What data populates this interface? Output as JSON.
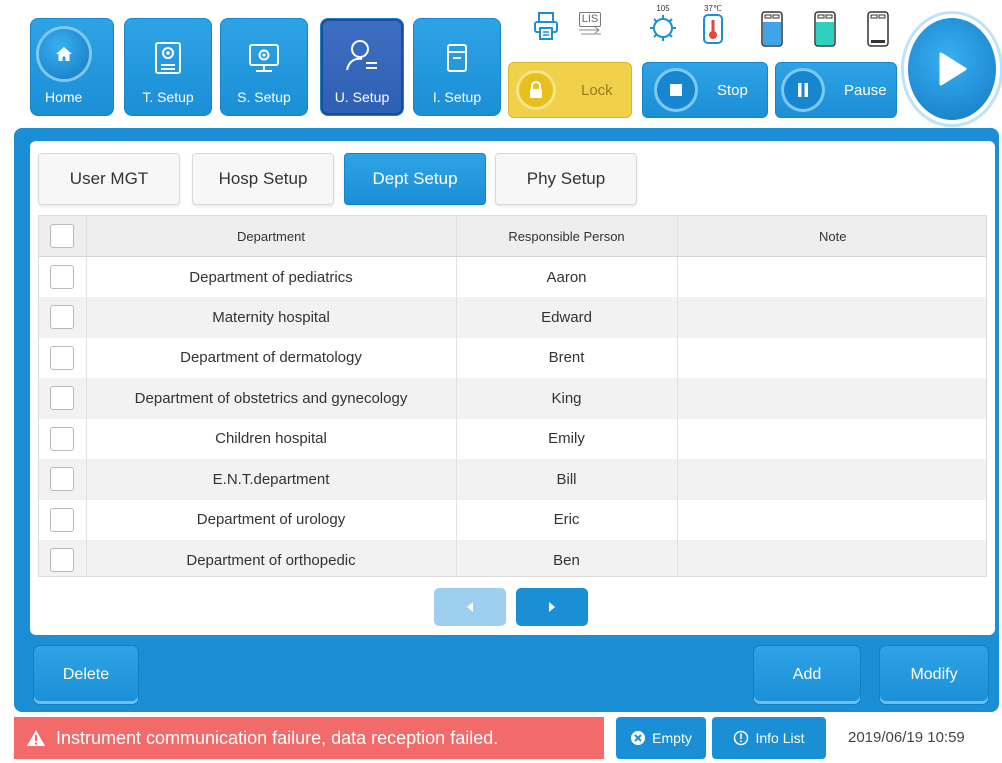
{
  "nav": {
    "home": "Home",
    "items": [
      {
        "label": "T. Setup",
        "icon": "test-setup-icon"
      },
      {
        "label": "S. Setup",
        "icon": "system-setup-icon"
      },
      {
        "label": "U. Setup",
        "icon": "user-setup-icon",
        "active": true
      },
      {
        "label": "I. Setup",
        "icon": "instrument-setup-icon"
      }
    ]
  },
  "status_icons": {
    "lis": "LIS",
    "reagent_count": "105",
    "temperature": "37℃"
  },
  "controls": {
    "lock": "Lock",
    "stop": "Stop",
    "pause": "Pause"
  },
  "tabs": [
    "User MGT",
    "Hosp Setup",
    "Dept Setup",
    "Phy Setup"
  ],
  "active_tab": "Dept Setup",
  "table": {
    "headers": [
      "Department",
      "Responsible Person",
      "Note"
    ],
    "rows": [
      {
        "department": "Department of pediatrics",
        "person": "Aaron",
        "note": ""
      },
      {
        "department": "Maternity hospital",
        "person": "Edward",
        "note": ""
      },
      {
        "department": "Department of dermatology",
        "person": "Brent",
        "note": ""
      },
      {
        "department": "Department of obstetrics and gynecology",
        "person": "King",
        "note": ""
      },
      {
        "department": "Children hospital",
        "person": "Emily",
        "note": ""
      },
      {
        "department": "E.N.T.department",
        "person": "Bill",
        "note": ""
      },
      {
        "department": "Department of urology",
        "person": "Eric",
        "note": ""
      },
      {
        "department": "Department of orthopedic",
        "person": "Ben",
        "note": ""
      }
    ]
  },
  "actions": {
    "delete": "Delete",
    "add": "Add",
    "modify": "Modify"
  },
  "statusbar": {
    "alert": "Instrument communication failure, data reception failed.",
    "empty": "Empty",
    "info_list": "Info List",
    "datetime": "2019/06/19 10:59"
  },
  "colors": {
    "primary": "#1a8fd6",
    "active_nav": "#2d5fb3",
    "lock": "#f2d14a",
    "alert": "#f26a6a"
  }
}
